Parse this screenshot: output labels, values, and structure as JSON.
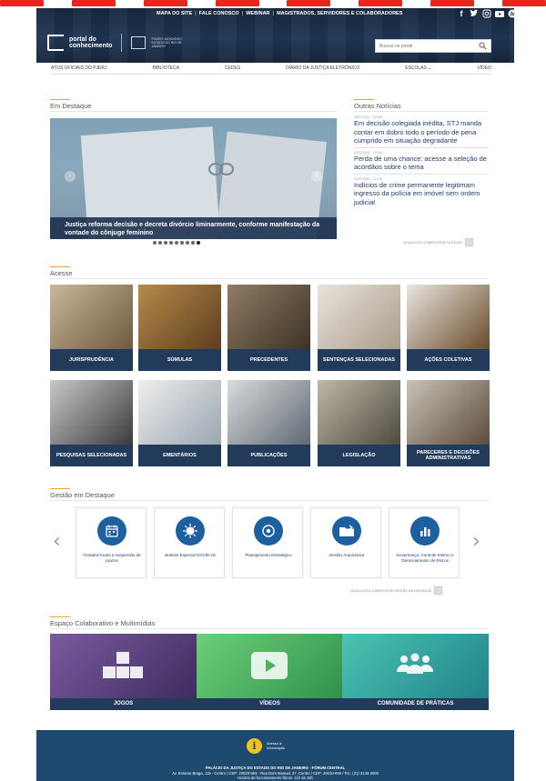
{
  "topnav": [
    "MAPA DO SITE",
    "FALE CONOSCO",
    "WEBINAR",
    "MAGISTRADOS, SERVIDORES E COLABORADORES"
  ],
  "social_icons": [
    "facebook-icon",
    "twitter-icon",
    "instagram-icon",
    "youtube-icon",
    "rss-icon"
  ],
  "logo": {
    "line1": "portal do",
    "line2": "conhecimento",
    "pj_text": "PODER JUDICIÁRIO ESTADO DO RIO DE JANEIRO"
  },
  "search": {
    "placeholder": "Buscar no portal"
  },
  "mainnav": [
    "ATOS OFICIAIS DO PJERJ",
    "BIBLIOTECA",
    "CEDES",
    "DIÁRIO DA JUSTIÇA ELETRÔNICO",
    "ESCOLAS",
    "VÍDEO"
  ],
  "destaque": {
    "heading": "Em Destaque",
    "caption": "Justiça reforma decisão e decreta divórcio liminarmente, conforme manifestação da vontade do cônjuge feminino",
    "slide_count": 9,
    "active_slide": 9
  },
  "news": {
    "heading": "Outras Notícias",
    "items": [
      {
        "date": "03/07/2021 - 15:30h",
        "title": "Em decisão colegiada inédita, STJ manda contar em dobro todo o período de pena cumprido em situação degradante"
      },
      {
        "date": "02/07/2021 - 19:31h",
        "title": "Perda de uma chance: acesse a seleção de acórdãos sobre o tema"
      },
      {
        "date": "02/07/2021 - 13:27h",
        "title": "Indícios de crime permanente legitimam ingresso da polícia em imóvel sem ordem judicial"
      }
    ],
    "more": "VEJA A LISTA COMPLETA DE NOTÍCIAS"
  },
  "acesse": {
    "heading": "Acesse",
    "tiles": [
      {
        "label": "JURISPRUDÊNCIA",
        "c1": "#c9b79a",
        "c2": "#6e5a3e"
      },
      {
        "label": "SÚMULAS",
        "c1": "#b58a4a",
        "c2": "#5e3d1f"
      },
      {
        "label": "PRECEDENTES",
        "c1": "#8f7d64",
        "c2": "#3c3226"
      },
      {
        "label": "SENTENÇAS SELECIONADAS",
        "c1": "#e9e4dc",
        "c2": "#a99c8c"
      },
      {
        "label": "AÇÕES COLETIVAS",
        "c1": "#e9e6e1",
        "c2": "#6b4a2a"
      },
      {
        "label": "PESQUISAS SELECIONADAS",
        "c1": "#c6c8c9",
        "c2": "#3a3b3c"
      },
      {
        "label": "EMENTÁRIOS",
        "c1": "#eeeeee",
        "c2": "#9aa6b0"
      },
      {
        "label": "PUBLICAÇÕES",
        "c1": "#d9dadb",
        "c2": "#5f6a74"
      },
      {
        "label": "LEGISLAÇÃO",
        "c1": "#bfb8a8",
        "c2": "#4f4a40"
      },
      {
        "label": "PARECERES E DECISÕES ADMINISTRATIVAS",
        "c1": "#c9c2b8",
        "c2": "#5b4b3c"
      }
    ]
  },
  "gestao": {
    "heading": "Gestão em Destaque",
    "cards": [
      {
        "label": "Feriados locais e suspensão de prazos",
        "icon": "calendar-icon"
      },
      {
        "label": "Boletim Especial COVID-19",
        "icon": "virus-icon"
      },
      {
        "label": "Planejamento Estratégico",
        "icon": "target-icon"
      },
      {
        "label": "Gestão Arquivística",
        "icon": "folder-icon"
      },
      {
        "label": "Governança, Controle Interno e Gerenciamento de Riscos",
        "icon": "bar-chart-icon"
      }
    ],
    "more": "VEJA A LISTA COMPLETA DE GESTÃO EM DESTAQUE"
  },
  "espaco": {
    "heading": "Espaço Colaborativo e Multimídias",
    "items": [
      {
        "label": "JOGOS",
        "c1": "#6b4d8f",
        "c2": "#3d2a5c"
      },
      {
        "label": "VÍDEOS",
        "c1": "#5fbf6b",
        "c2": "#2f8a4a"
      },
      {
        "label": "COMUNIDADE DE PRÁTICAS",
        "c1": "#3fb5a5",
        "c2": "#1e7f86"
      }
    ]
  },
  "footer": {
    "ai_line1": "Acesso à",
    "ai_line2": "Informação",
    "addr1": "PALÁCIO DA JUSTIÇA DO ESTADO DO RIO DE JANEIRO - FÓRUM CENTRAL",
    "addr2": "Av. Erasmo Braga, 115 - Centro / CEP: 20020-903 - Rua Dom Manuel, 37, Centro / CEP: 20010-090 / Tel.: (21) 3133-2000",
    "addr3": "Horário de funcionamento fórum: 11h às 18h"
  }
}
